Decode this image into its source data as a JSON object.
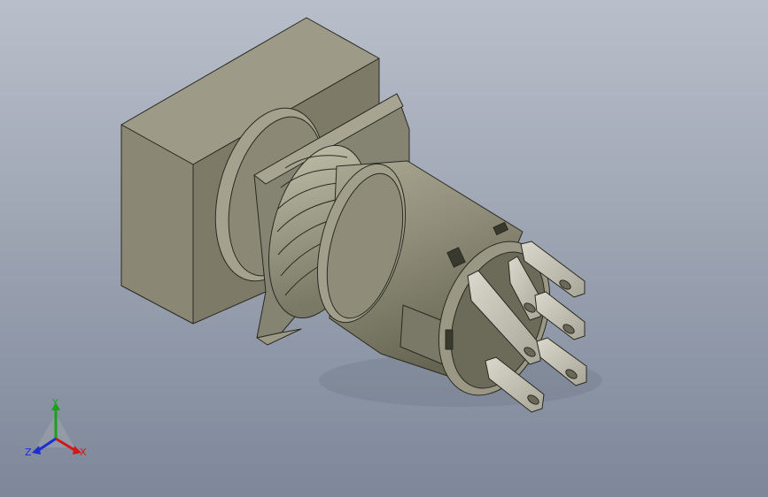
{
  "viewport": {
    "background_top": "#b9bfca",
    "background_bottom": "#7d8799"
  },
  "model": {
    "body_color": "#8e8c79",
    "body_dark": "#6a6957",
    "body_light": "#a3a18d",
    "thread_color": "#b0ae99",
    "terminal_color": "#c9c7bb",
    "edge_color": "#2a2a22"
  },
  "triad": {
    "x_label": "X",
    "y_label": "Y",
    "z_label": "Z",
    "x_color": "#d01818",
    "y_color": "#19a319",
    "z_color": "#1a2fd0"
  }
}
